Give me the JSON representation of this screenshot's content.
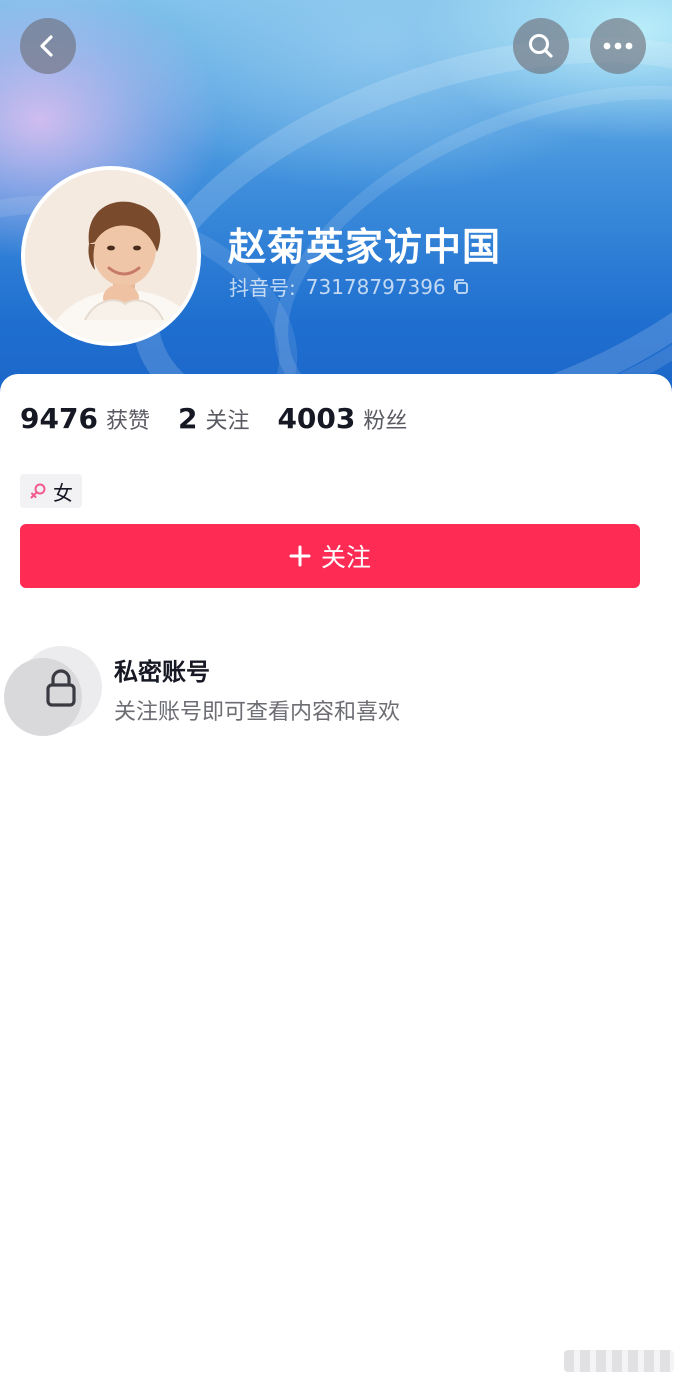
{
  "profile": {
    "name": "赵菊英家访中国",
    "id_label": "抖音号:",
    "id_value": "73178797396"
  },
  "stats": [
    {
      "value": "9476",
      "label": "获赞"
    },
    {
      "value": "2",
      "label": "关注"
    },
    {
      "value": "4003",
      "label": "粉丝"
    }
  ],
  "tags": {
    "gender": "女"
  },
  "actions": {
    "follow_label": "关注"
  },
  "private": {
    "title": "私密账号",
    "description": "关注账号即可查看内容和喜欢"
  },
  "icons": {
    "back": "chevron-left-icon",
    "search": "search-icon",
    "more": "more-horizontal-icon",
    "copy": "copy-icon",
    "gender": "female-icon",
    "plus": "plus-icon",
    "lock": "lock-icon"
  },
  "colors": {
    "accent": "#fe2c55",
    "banner_blue": "#1f6fd0",
    "text_primary": "#161823",
    "text_secondary": "#6d6e74"
  }
}
